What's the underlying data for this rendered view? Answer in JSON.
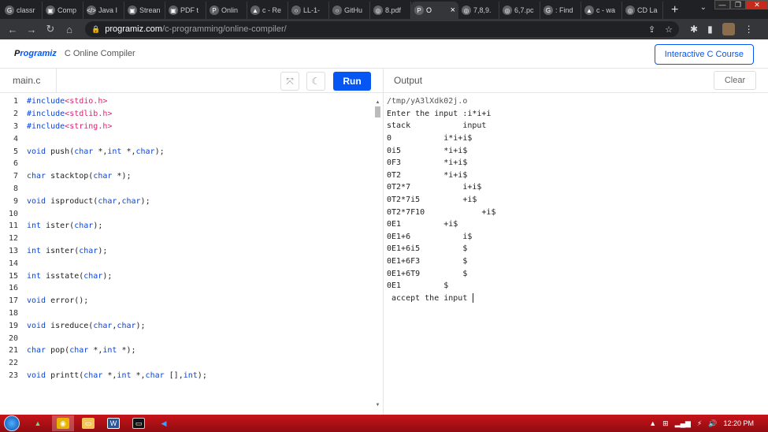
{
  "browser": {
    "tabs": [
      {
        "title": "classr",
        "icon": "G"
      },
      {
        "title": "Comp",
        "icon": "▣"
      },
      {
        "title": "Java I",
        "icon": "</>"
      },
      {
        "title": "Strean",
        "icon": "▣"
      },
      {
        "title": "PDF t",
        "icon": "▣"
      },
      {
        "title": "Onlin",
        "icon": "P"
      },
      {
        "title": "c - Re",
        "icon": "▲"
      },
      {
        "title": "LL-1-",
        "icon": "○"
      },
      {
        "title": "GitHu",
        "icon": "○"
      },
      {
        "title": "8.pdf",
        "icon": "◎"
      },
      {
        "title": "O",
        "icon": "P",
        "active": true
      },
      {
        "title": "7,8,9.",
        "icon": "◎"
      },
      {
        "title": "6,7.pc",
        "icon": "◎"
      },
      {
        "title": ": Find",
        "icon": "G"
      },
      {
        "title": "c - wa",
        "icon": "▲"
      },
      {
        "title": "CD La",
        "icon": "◎"
      }
    ],
    "url_host": "programiz.com",
    "url_path": "/c-programming/online-compiler/"
  },
  "site": {
    "logo": "rogramiz",
    "logo_p": "P",
    "subtitle": "C Online Compiler",
    "course_button": "Interactive C Course"
  },
  "editor": {
    "file": "main.c",
    "run_label": "Run",
    "lines": [
      [
        [
          "inc",
          "#include"
        ],
        [
          "str",
          "<stdio.h>"
        ]
      ],
      [
        [
          "inc",
          "#include"
        ],
        [
          "str",
          "<stdlib.h>"
        ]
      ],
      [
        [
          "inc",
          "#include"
        ],
        [
          "str",
          "<string.h>"
        ]
      ],
      [],
      [
        [
          "kw",
          "void"
        ],
        [
          "tx",
          " push("
        ],
        [
          "kw",
          "char"
        ],
        [
          "tx",
          " *,"
        ],
        [
          "kw",
          "int"
        ],
        [
          "tx",
          " *,"
        ],
        [
          "kw",
          "char"
        ],
        [
          "tx",
          ");"
        ]
      ],
      [],
      [
        [
          "kw",
          "char"
        ],
        [
          "tx",
          " stacktop("
        ],
        [
          "kw",
          "char"
        ],
        [
          "tx",
          " *);"
        ]
      ],
      [],
      [
        [
          "kw",
          "void"
        ],
        [
          "tx",
          " isproduct("
        ],
        [
          "kw",
          "char"
        ],
        [
          "tx",
          ","
        ],
        [
          "kw",
          "char"
        ],
        [
          "tx",
          ");"
        ]
      ],
      [],
      [
        [
          "kw",
          "int"
        ],
        [
          "tx",
          " ister("
        ],
        [
          "kw",
          "char"
        ],
        [
          "tx",
          ");"
        ]
      ],
      [],
      [
        [
          "kw",
          "int"
        ],
        [
          "tx",
          " isnter("
        ],
        [
          "kw",
          "char"
        ],
        [
          "tx",
          ");"
        ]
      ],
      [],
      [
        [
          "kw",
          "int"
        ],
        [
          "tx",
          " isstate("
        ],
        [
          "kw",
          "char"
        ],
        [
          "tx",
          ");"
        ]
      ],
      [],
      [
        [
          "kw",
          "void"
        ],
        [
          "tx",
          " error();"
        ]
      ],
      [],
      [
        [
          "kw",
          "void"
        ],
        [
          "tx",
          " isreduce("
        ],
        [
          "kw",
          "char"
        ],
        [
          "tx",
          ","
        ],
        [
          "kw",
          "char"
        ],
        [
          "tx",
          ");"
        ]
      ],
      [],
      [
        [
          "kw",
          "char"
        ],
        [
          "tx",
          " pop("
        ],
        [
          "kw",
          "char"
        ],
        [
          "tx",
          " *,"
        ],
        [
          "kw",
          "int"
        ],
        [
          "tx",
          " *);"
        ]
      ],
      [],
      [
        [
          "kw",
          "void"
        ],
        [
          "tx",
          " printt("
        ],
        [
          "kw",
          "char"
        ],
        [
          "tx",
          " *,"
        ],
        [
          "kw",
          "int"
        ],
        [
          "tx",
          " *,"
        ],
        [
          "kw",
          "char"
        ],
        [
          "tx",
          " [],"
        ],
        [
          "kw",
          "int"
        ],
        [
          "tx",
          ");"
        ]
      ]
    ]
  },
  "output": {
    "title": "Output",
    "clear_label": "Clear",
    "lines": [
      "/tmp/yA3lXdk02j.o",
      "Enter the input :i*i+i",
      "stack           input",
      "0           i*i+i$",
      "0i5         *i+i$",
      "0F3         *i+i$",
      "0T2         *i+i$",
      "0T2*7           i+i$",
      "0T2*7i5         +i$",
      "0T2*7F10            +i$",
      "0E1         +i$",
      "0E1+6           i$",
      "0E1+6i5         $",
      "0E1+6F3         $",
      "0E1+6T9         $",
      "0E1         $",
      " accept the input "
    ]
  },
  "taskbar": {
    "time": "12:20 PM"
  }
}
